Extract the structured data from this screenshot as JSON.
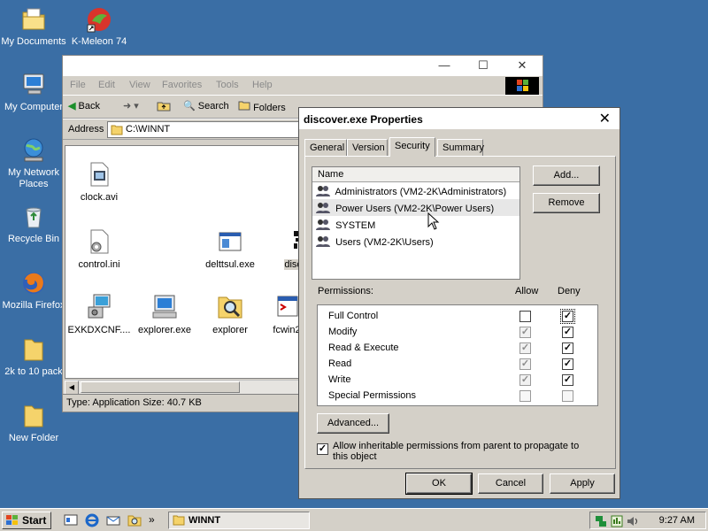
{
  "desktop": {
    "icons": [
      {
        "label": "My Documents",
        "icon": "folder-documents-icon"
      },
      {
        "label": "K-Meleon 74",
        "icon": "kmeleon-icon"
      },
      {
        "label": "My Computer",
        "icon": "computer-icon"
      },
      {
        "label": "My Network Places",
        "icon": "network-icon"
      },
      {
        "label": "Recycle Bin",
        "icon": "recycle-bin-icon"
      },
      {
        "label": "Mozilla Firefox",
        "icon": "firefox-icon"
      },
      {
        "label": "2k to 10 pack",
        "icon": "folder-icon"
      },
      {
        "label": "New Folder",
        "icon": "folder-icon"
      }
    ]
  },
  "explorer": {
    "caption_buttons": {
      "minimize": "—",
      "maximize": "☐",
      "close": "✕"
    },
    "menu": [
      "File",
      "Edit",
      "View",
      "Favorites",
      "Tools",
      "Help"
    ],
    "toolbar": {
      "back": "Back",
      "search": "Search",
      "folders": "Folders"
    },
    "address_label": "Address",
    "address_value": "C:\\WINNT",
    "files": [
      {
        "name": "clock.avi",
        "icon": "video-file-icon"
      },
      {
        "name": "control.ini",
        "icon": "ini-file-icon"
      },
      {
        "name": "delttsul.exe",
        "icon": "exe-file-icon"
      },
      {
        "name": "discove",
        "icon": "discover-exe-icon"
      },
      {
        "name": "EXKDXCNF....",
        "icon": "setup-exe-icon"
      },
      {
        "name": "explorer.exe",
        "icon": "explorer-exe-icon"
      },
      {
        "name": "explorer",
        "icon": "folder-search-icon"
      },
      {
        "name": "fcwin2",
        "icon": "fcwin-exe-icon"
      }
    ],
    "status": "Type: Application Size: 40.7 KB"
  },
  "dialog": {
    "title": "discover.exe Properties",
    "close": "✕",
    "tabs": [
      "General",
      "Version",
      "Security",
      "Summary"
    ],
    "active_tab": "Security",
    "name_header": "Name",
    "names": [
      "Administrators (VM2-2K\\Administrators)",
      "Power Users (VM2-2K\\Power Users)",
      "SYSTEM",
      "Users (VM2-2K\\Users)"
    ],
    "selected_name": "Power Users (VM2-2K\\Power Users)",
    "add_button": "Add...",
    "remove_button": "Remove",
    "permissions_label": "Permissions:",
    "allow_label": "Allow",
    "deny_label": "Deny",
    "permissions": [
      {
        "name": "Full Control",
        "allow": "unchecked",
        "deny": "checked"
      },
      {
        "name": "Modify",
        "allow": "checked-disabled",
        "deny": "checked"
      },
      {
        "name": "Read & Execute",
        "allow": "checked-disabled",
        "deny": "checked"
      },
      {
        "name": "Read",
        "allow": "checked-disabled",
        "deny": "checked"
      },
      {
        "name": "Write",
        "allow": "checked-disabled",
        "deny": "checked"
      },
      {
        "name": "Special Permissions",
        "allow": "unchecked-disabled",
        "deny": "unchecked-disabled"
      }
    ],
    "advanced_button": "Advanced...",
    "inherit_checked": true,
    "inherit_text": "Allow inheritable permissions from parent to propagate to this object",
    "ok_button": "OK",
    "cancel_button": "Cancel",
    "apply_button": "Apply"
  },
  "taskbar": {
    "start_label": "Start",
    "quicklaunch_more": "»",
    "task_label": "WINNT",
    "clock": "9:27 AM"
  },
  "colors": {
    "desktop": "#3a6ea5",
    "face": "#d4d0c8"
  }
}
